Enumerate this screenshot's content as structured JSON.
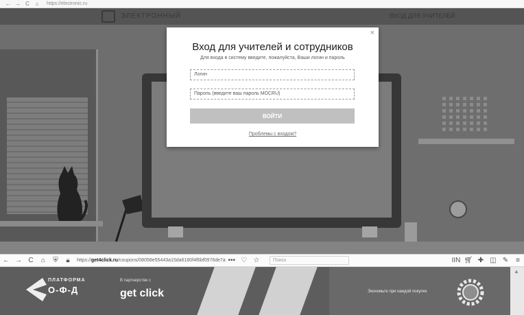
{
  "top_strip": {
    "icons": [
      "←",
      "→",
      "C",
      "⌂"
    ],
    "url": "https://electronic.ru"
  },
  "background": {
    "header_title": "ЭЛЕКТРОННЫЙ",
    "header_right": "ВХОД ДЛЯ УЧИТЕЛЕЙ"
  },
  "modal": {
    "close": "×",
    "title": "Вход для учителей и сотрудников",
    "subtitle": "Для входа в систему введите, пожалуйста, Ваши логин и пароль",
    "login_placeholder": "Логин",
    "password_placeholder": "Пароль (введите ваш пароль МОСRU)",
    "submit_label": "ВОЙТИ",
    "forgot_label": "Проблемы с входом?"
  },
  "browser": {
    "back": "←",
    "forward": "→",
    "reload": "C",
    "home": "⌂",
    "url_prefix": "https://",
    "url_domain": "get4click.ru",
    "url_path": "/coupons/08058e55443a15da6180f4f6bf0976de7a",
    "more": "•••",
    "pocket": "♡",
    "star": "☆",
    "search_placeholder": "Поиск",
    "library": "IIN",
    "menu": "≡"
  },
  "banner": {
    "platform_title": "ПЛАТФОРМА",
    "platform_sub": "О-Ф-Д",
    "partner_note": "В партнерстве с",
    "getclick": "get click",
    "promo": "Экономьте при каждой покупке"
  },
  "colors": {
    "scene_bg": "#6f6f6f",
    "modal_bg": "#ffffff",
    "submit_bg": "#bdbdbd",
    "banner_dark": "#5f5f5f"
  }
}
